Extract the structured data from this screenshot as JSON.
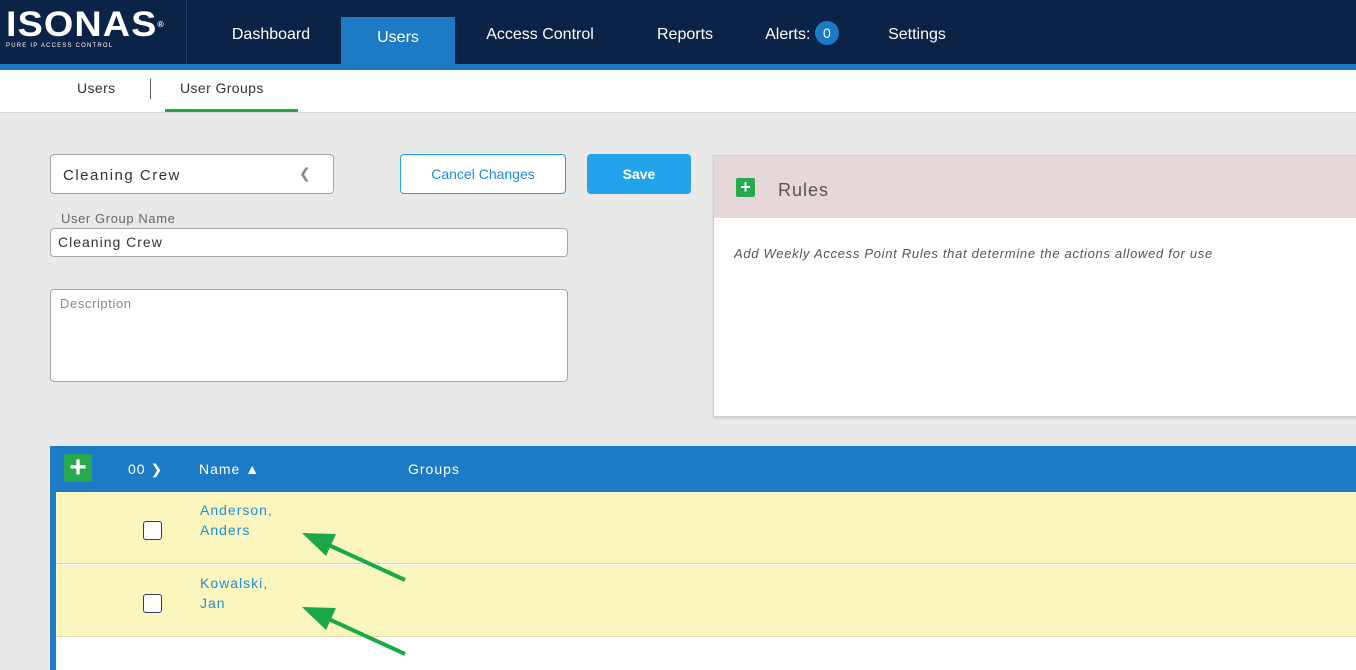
{
  "logo": {
    "main": "ISONAS",
    "trademark": "®",
    "sub": "PURE IP ACCESS CONTROL"
  },
  "nav": {
    "items": [
      {
        "label": "Dashboard"
      },
      {
        "label": "Users"
      },
      {
        "label": "Access Control"
      },
      {
        "label": "Reports"
      },
      {
        "label": "Alerts:"
      },
      {
        "label": "Settings"
      }
    ],
    "alerts_count": "0",
    "active": "Users"
  },
  "subnav": {
    "users": "Users",
    "user_groups": "User Groups",
    "active": "User Groups"
  },
  "form": {
    "group_select": "Cleaning Crew",
    "cancel_label": "Cancel Changes",
    "save_label": "Save",
    "name_label": "User Group Name",
    "name_value": "Cleaning Crew",
    "description_placeholder": "Description"
  },
  "rules": {
    "title": "Rules",
    "text": "Add Weekly Access Point Rules that determine the actions allowed for use"
  },
  "table": {
    "select_label": "00",
    "columns": [
      "Name ▲",
      "Groups"
    ],
    "rows": [
      {
        "name_line1": "Anderson,",
        "name_line2": "Anders"
      },
      {
        "name_line1": "Kowalski,",
        "name_line2": "Jan"
      }
    ]
  },
  "colors": {
    "nav_bg": "#0b2346",
    "accent_blue": "#1c7bc4",
    "save_blue": "#22a3ec",
    "plus_green": "#27a94e",
    "row_yellow": "#fbf6bd",
    "rules_header": "#e6d8d9",
    "annotation_arrow": "#1aa84a"
  }
}
